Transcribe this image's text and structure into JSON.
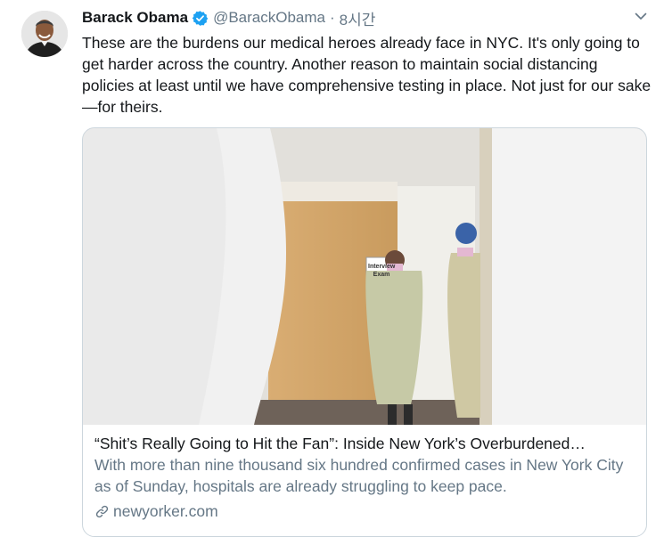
{
  "tweet": {
    "author_name": "Barack Obama",
    "handle": "@BarackObama",
    "separator": "·",
    "time": "8시간",
    "text": "These are the burdens our medical heroes already face in NYC. It's only going to get harder across the country. Another reason to maintain social distancing policies at least until we have comprehensive testing in place. Not just for our sake—for theirs.",
    "icons": {
      "verified": "verified-badge-icon",
      "more": "chevron-down-icon",
      "link": "link-icon"
    },
    "colors": {
      "verified": "#1da1f2",
      "secondary_text": "#657786",
      "border": "#ccd6dd"
    }
  },
  "card": {
    "sign_text": "Interview Exam",
    "title": "“Shit’s Really Going to Hit the Fan”: Inside New York’s Overburdened…",
    "description": "With more than nine thousand six hundred confirmed cases in New York City as of Sunday, hospitals are already struggling to keep pace.",
    "domain": "newyorker.com"
  }
}
